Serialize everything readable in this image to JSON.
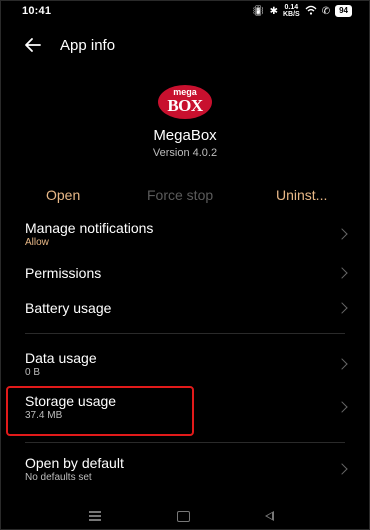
{
  "status": {
    "time": "10:41",
    "net_speed": "0.14",
    "net_unit": "KB/S",
    "battery": "94"
  },
  "header": {
    "title": "App info",
    "back_icon": "arrow-left-icon"
  },
  "app": {
    "logo_top": "mega",
    "logo_bottom": "BOX",
    "name": "MegaBox",
    "version": "Version 4.0.2"
  },
  "actions": {
    "open": "Open",
    "force_stop": "Force stop",
    "uninstall": "Uninst..."
  },
  "rows": {
    "notifications": {
      "label": "Manage notifications",
      "sub": "Allow"
    },
    "permissions": {
      "label": "Permissions"
    },
    "battery": {
      "label": "Battery usage"
    },
    "data": {
      "label": "Data usage",
      "sub": "0 B"
    },
    "storage": {
      "label": "Storage usage",
      "sub": "37.4 MB"
    },
    "open_default": {
      "label": "Open by default",
      "sub": "No defaults set"
    }
  },
  "colors": {
    "accent": "#e8b887",
    "disabled": "#5b5b5b",
    "highlight": "#e21a1a",
    "background": "#000000"
  }
}
